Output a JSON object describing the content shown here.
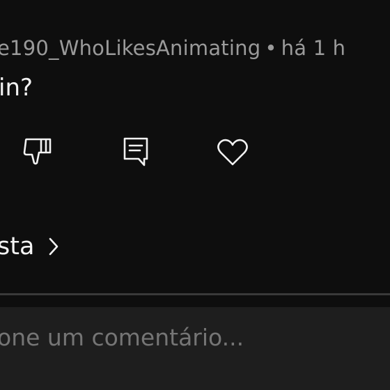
{
  "comment": {
    "author": "e190_WhoLikesAnimating",
    "separator": "•",
    "time": "há 1 h",
    "text": "in?"
  },
  "actions": {
    "dislike_icon": "thumbs-down-icon",
    "reply_icon": "comment-icon",
    "like_icon": "heart-icon"
  },
  "replies": {
    "label": "sta",
    "icon": "chevron-right-icon"
  },
  "composer": {
    "placeholder": "one um comentário..."
  },
  "colors": {
    "background": "#0e0e0e",
    "composer_background": "#1e1e1e",
    "meta_text": "#9a9a9a",
    "primary_text": "#f2f2f2",
    "divider": "#3a3a3a"
  }
}
